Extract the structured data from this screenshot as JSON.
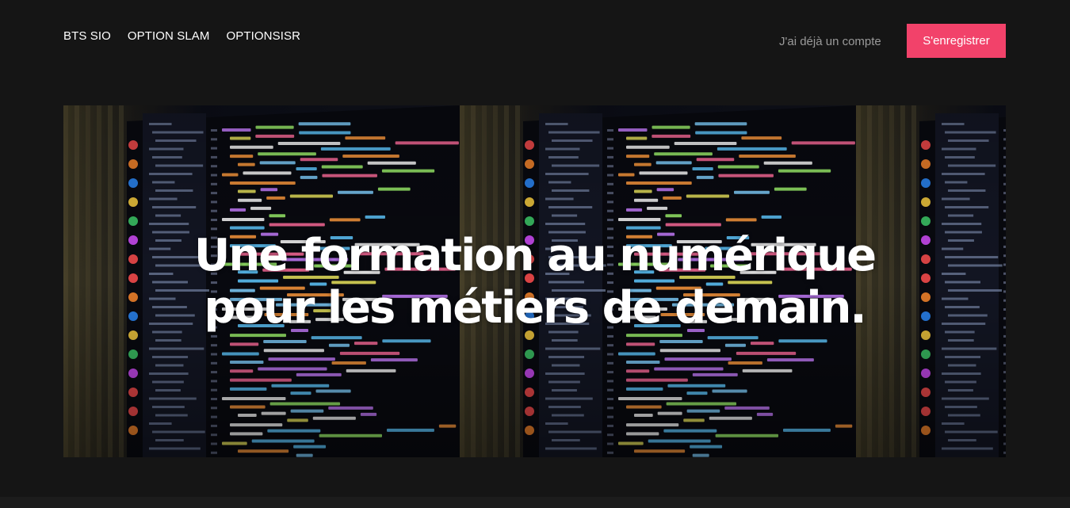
{
  "nav": {
    "items": [
      {
        "label": "BTS SIO"
      },
      {
        "label": "OPTION SLAM"
      },
      {
        "label": "OPTIONSISR"
      }
    ]
  },
  "auth": {
    "login_label": "J'ai déjà un compte",
    "register_label": "S'enregistrer"
  },
  "hero": {
    "title_line1": "Une formation au numérique",
    "title_line2": "pour les métiers de demain.",
    "image_icon": "code-editor-photo"
  },
  "colors": {
    "background": "#151515",
    "accent": "#f2426a",
    "muted_text": "#9a9a9a"
  }
}
